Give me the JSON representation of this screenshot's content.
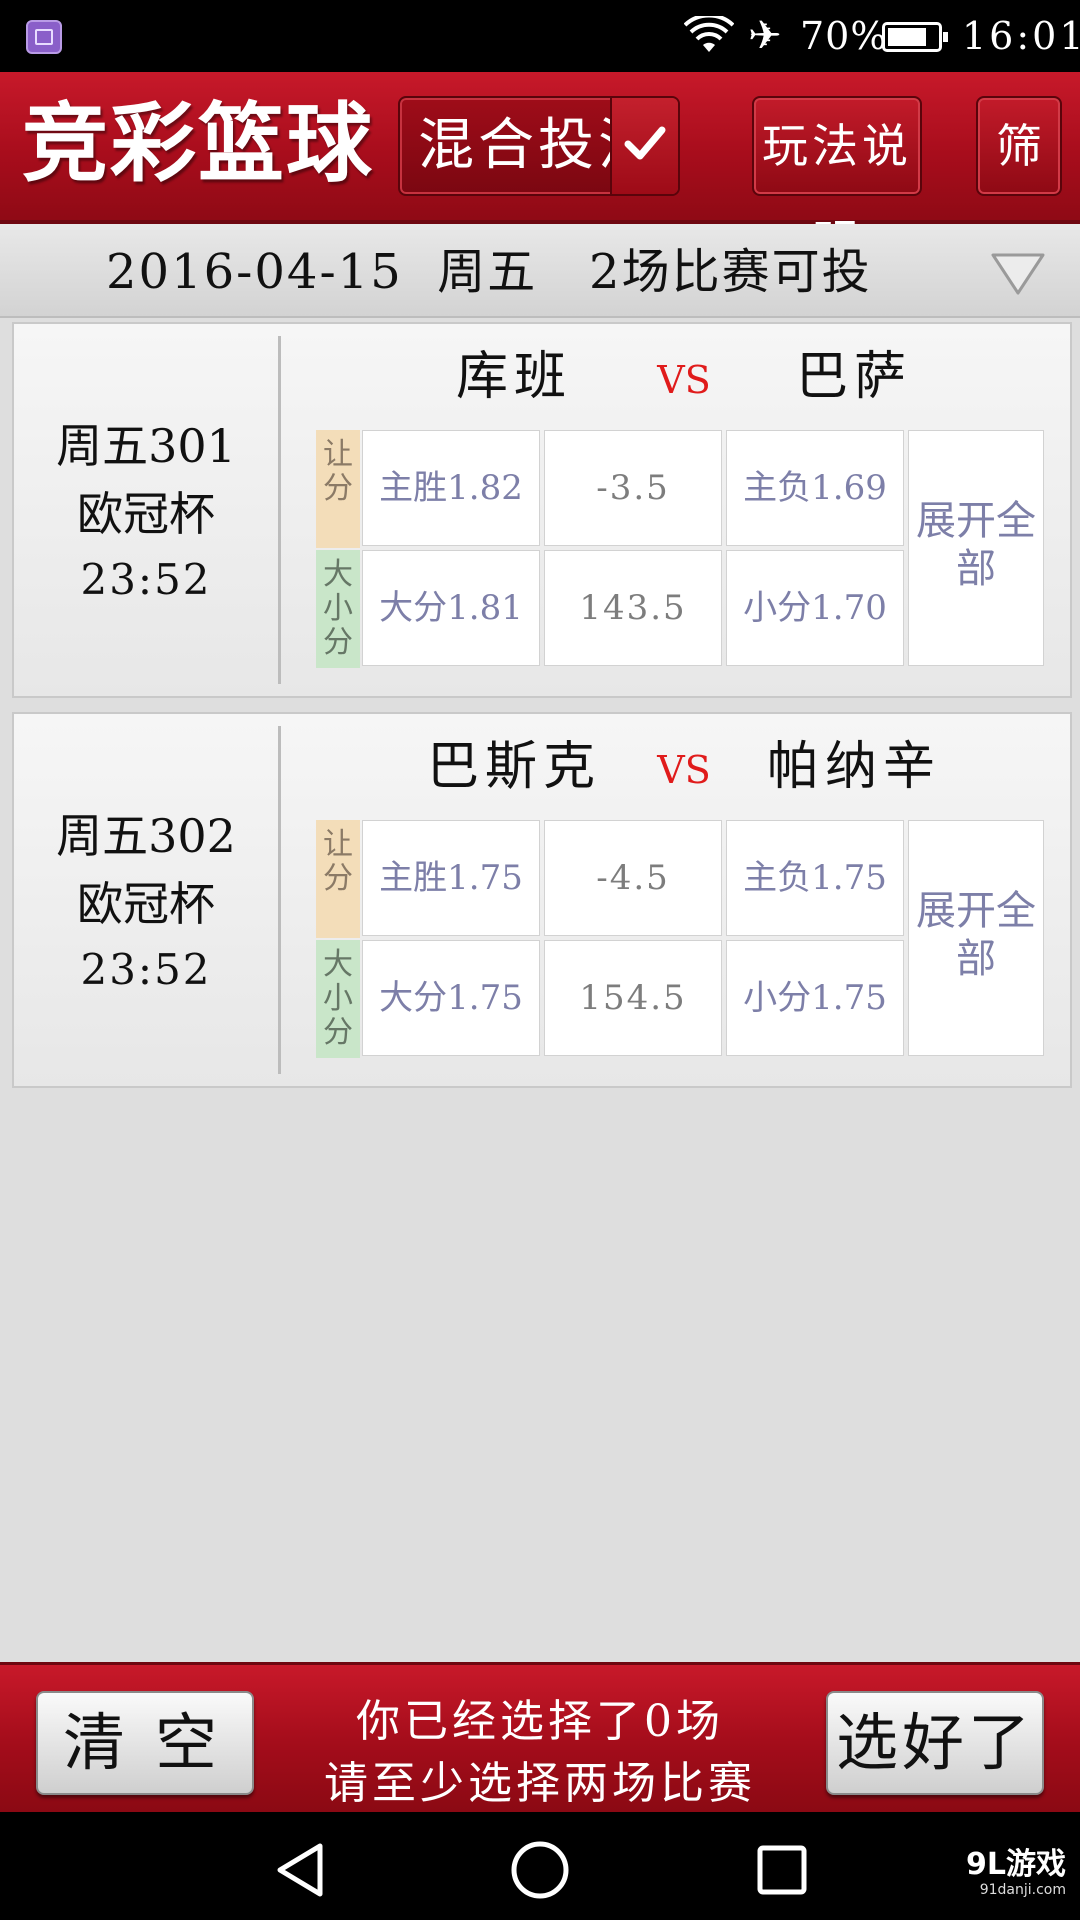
{
  "status_bar": {
    "battery": "70%",
    "time": "16:01"
  },
  "header": {
    "title": "竞彩篮球",
    "mode": "混合投注",
    "rules_button": "玩法说明",
    "filter_button": "筛"
  },
  "date_bar": {
    "text": "2016-04-15  周五   2场比赛可投"
  },
  "matches": [
    {
      "code": "周五301",
      "league": "欧冠杯",
      "time": "23:52",
      "home": "库班",
      "vs": "VS",
      "away": "巴萨",
      "row1_label": "让分",
      "row2_label": "大小分",
      "handicap": {
        "home": "主胜1.82",
        "line": "-3.5",
        "away": "主负1.69"
      },
      "total": {
        "over": "大分1.81",
        "line": "143.5",
        "under": "小分1.70"
      },
      "expand": "展开全部"
    },
    {
      "code": "周五302",
      "league": "欧冠杯",
      "time": "23:52",
      "home": "巴斯克",
      "vs": "VS",
      "away": "帕纳辛",
      "row1_label": "让分",
      "row2_label": "大小分",
      "handicap": {
        "home": "主胜1.75",
        "line": "-4.5",
        "away": "主负1.75"
      },
      "total": {
        "over": "大分1.75",
        "line": "154.5",
        "under": "小分1.75"
      },
      "expand": "展开全部"
    }
  ],
  "footer": {
    "clear_button": "清空",
    "message_line1": "你已经选择了0场",
    "message_line2": "请至少选择两场比赛",
    "done_button": "选好了"
  },
  "watermark": {
    "brand": "9L游戏",
    "site": "91danji.com"
  },
  "colors": {
    "header_red": "#b3111f",
    "vs_red": "#e01b1b",
    "odds_text": "#7d7fa8"
  }
}
